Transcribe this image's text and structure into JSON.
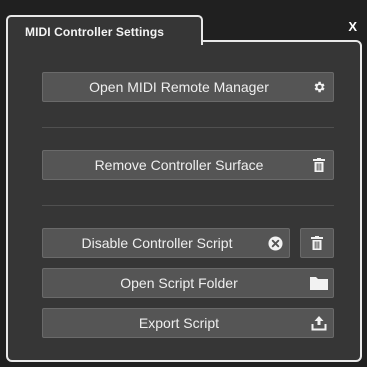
{
  "dialog": {
    "tab_title": "MIDI Controller Settings",
    "close_label": "X"
  },
  "buttons": {
    "open_remote_manager": "Open MIDI Remote Manager",
    "remove_surface": "Remove Controller Surface",
    "disable_script": "Disable Controller Script",
    "open_script_folder": "Open Script Folder",
    "export_script": "Export Script"
  },
  "icons": {
    "open_remote_manager": "gear-icon",
    "remove_surface": "trash-icon",
    "disable_script": "circle-x-icon",
    "delete_script": "trash-icon",
    "open_script_folder": "folder-icon",
    "export_script": "export-icon"
  },
  "colors": {
    "panel_bg": "#363636",
    "button_bg": "#555555",
    "border": "#e9e9e9",
    "text": "#efefef"
  }
}
